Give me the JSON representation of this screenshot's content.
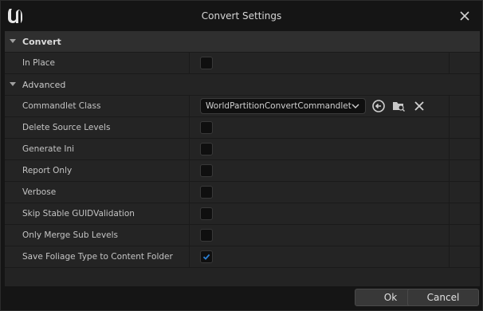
{
  "window": {
    "title": "Convert Settings"
  },
  "categories": {
    "convert": "Convert",
    "advanced": "Advanced"
  },
  "properties": {
    "in_place": {
      "label": "In Place",
      "checked": false
    },
    "commandlet_class": {
      "label": "Commandlet Class",
      "value": "WorldPartitionConvertCommandlet"
    },
    "delete_source_levels": {
      "label": "Delete Source Levels",
      "checked": false
    },
    "generate_ini": {
      "label": "Generate Ini",
      "checked": false
    },
    "report_only": {
      "label": "Report Only",
      "checked": false
    },
    "verbose": {
      "label": "Verbose",
      "checked": false
    },
    "skip_stable_guid_validation": {
      "label": "Skip Stable GUIDValidation",
      "checked": false
    },
    "only_merge_sub_levels": {
      "label": "Only Merge Sub Levels",
      "checked": false
    },
    "save_foliage_type": {
      "label": "Save Foliage Type to Content Folder",
      "checked": true
    }
  },
  "buttons": {
    "ok": "Ok",
    "cancel": "Cancel"
  },
  "icons": {
    "logo": "unreal-logo-icon",
    "close": "close-icon",
    "browse_to_asset": "browse-to-asset-icon",
    "browse_folder": "folder-search-icon",
    "clear": "clear-icon",
    "expand": "chevron-down-icon",
    "check": "checkmark-icon"
  },
  "colors": {
    "accent": "#2a7fd4",
    "background": "#151515",
    "row": "#242424"
  }
}
